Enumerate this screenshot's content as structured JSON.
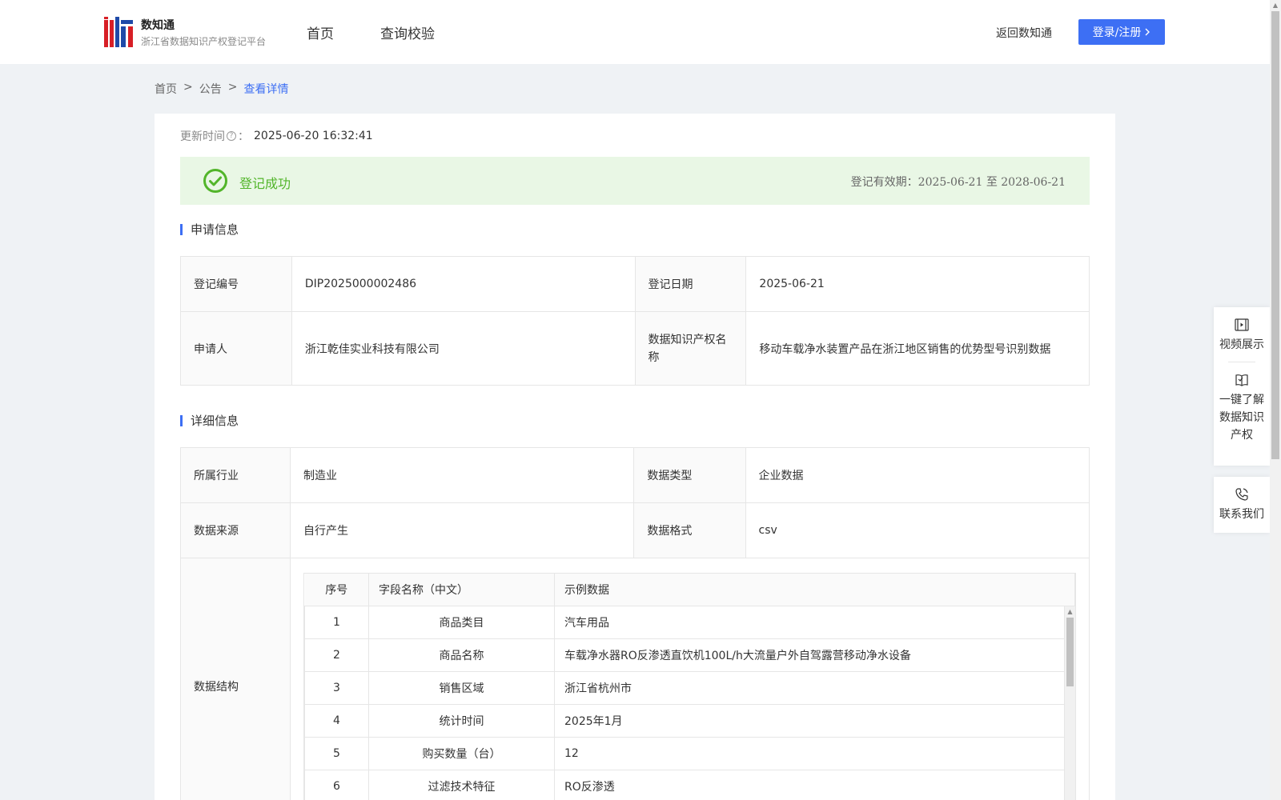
{
  "header": {
    "brand_name": "数知通",
    "brand_sub": "浙江省数据知识产权登记平台",
    "nav": [
      {
        "label": "首页"
      },
      {
        "label": "查询校验"
      }
    ],
    "back_link": "返回数知通",
    "login_label": "登录/注册"
  },
  "breadcrumb": [
    {
      "label": "首页"
    },
    {
      "label": "公告"
    },
    {
      "label": "查看详情"
    }
  ],
  "breadcrumb_sep": ">",
  "update": {
    "label": "更新时间",
    "value": "2025-06-20 16:32:41"
  },
  "status": {
    "text": "登记成功",
    "validity_label": "登记有效期：",
    "validity_range": "2025-06-21 至 2028-06-21",
    "color": "#52b52a",
    "bg_color": "#e9f7e5"
  },
  "apply_section": {
    "title": "申请信息",
    "rows": [
      {
        "l1": "登记编号",
        "v1": "DIP2025000002486",
        "l2": "登记日期",
        "v2": "2025-06-21"
      },
      {
        "l1": "申请人",
        "v1": "浙江乾佳实业科技有限公司",
        "l2": "数据知识产权名称",
        "v2": "移动车载净水装置产品在浙江地区销售的优势型号识别数据"
      }
    ]
  },
  "detail_section": {
    "title": "详细信息",
    "rows": [
      {
        "l1": "所属行业",
        "v1": "制造业",
        "l2": "数据类型",
        "v2": "企业数据"
      },
      {
        "l1": "数据来源",
        "v1": "自行产生",
        "l2": "数据格式",
        "v2": "csv"
      }
    ],
    "structure_label": "数据结构",
    "structure": {
      "headers": [
        "序号",
        "字段名称（中文）",
        "示例数据"
      ],
      "rows": [
        [
          "1",
          "商品类目",
          "汽车用品"
        ],
        [
          "2",
          "商品名称",
          "车载净水器RO反渗透直饮机100L/h大流量户外自驾露营移动净水设备"
        ],
        [
          "3",
          "销售区域",
          "浙江省杭州市"
        ],
        [
          "4",
          "统计时间",
          "2025年1月"
        ],
        [
          "5",
          "购买数量（台）",
          "12"
        ],
        [
          "6",
          "过滤技术特征",
          "RO反渗透"
        ]
      ]
    }
  },
  "side_float": [
    {
      "label": "视频展示",
      "icon": "video-icon"
    },
    {
      "label": "一键了解数据知识产权",
      "icon": "book-icon"
    },
    {
      "label": "联系我们",
      "icon": "phone-icon"
    }
  ],
  "colors": {
    "accent": "#3d6ff4",
    "success": "#52b52a"
  }
}
